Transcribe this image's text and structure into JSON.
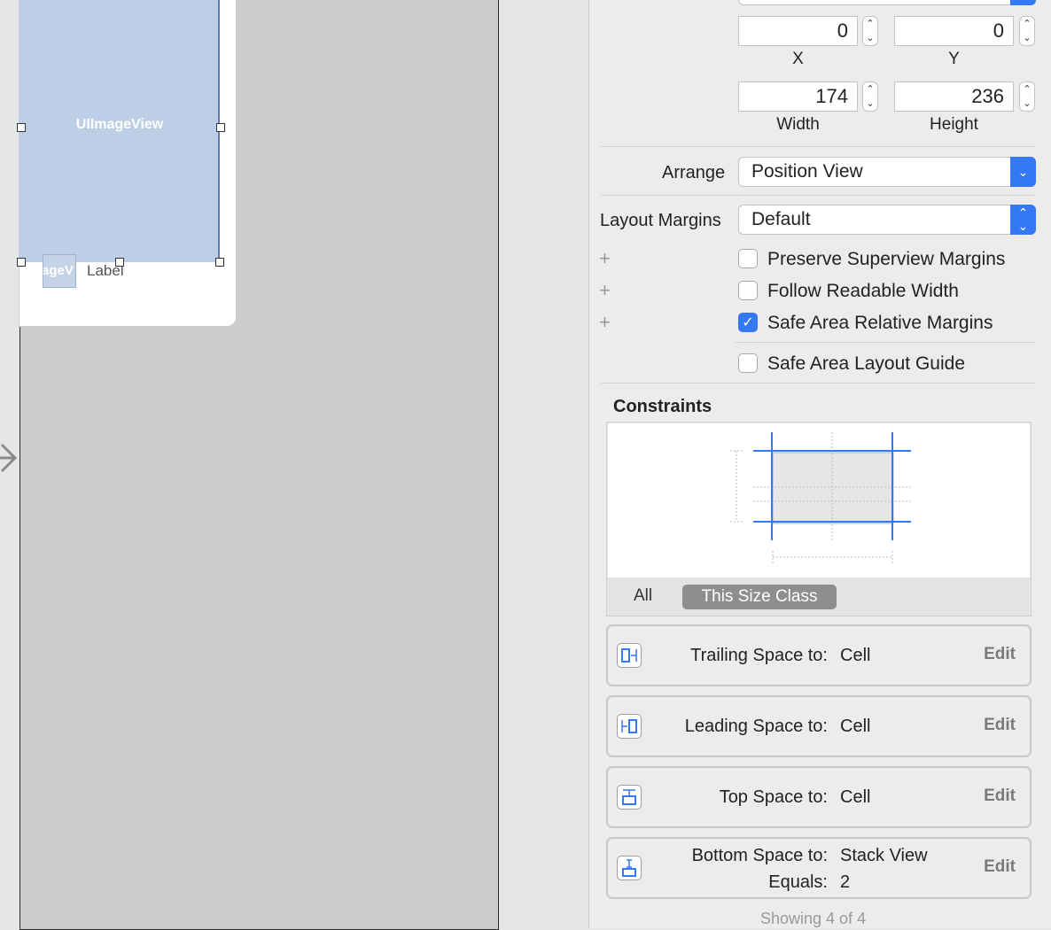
{
  "canvas": {
    "imageview_label": "UIImageView",
    "row_thumb_text": "ageV",
    "row_label": "Label"
  },
  "inspector": {
    "x_value": "0",
    "y_value": "0",
    "x_caption": "X",
    "y_caption": "Y",
    "width_value": "174",
    "height_value": "236",
    "width_caption": "Width",
    "height_caption": "Height",
    "arrange_label": "Arrange",
    "arrange_value": "Position View",
    "layout_margins_label": "Layout Margins",
    "layout_margins_value": "Default",
    "checkboxes": [
      {
        "label": "Preserve Superview Margins",
        "checked": false
      },
      {
        "label": "Follow Readable Width",
        "checked": false
      },
      {
        "label": "Safe Area Relative Margins",
        "checked": true
      },
      {
        "label": "Safe Area Layout Guide",
        "checked": false
      }
    ],
    "constraints_title": "Constraints",
    "segment_all": "All",
    "segment_size_class": "This Size Class",
    "constraint_rows": [
      {
        "label": "Trailing Space to:",
        "value": "Cell",
        "edit": "Edit",
        "icon": "trailing-space-icon"
      },
      {
        "label": "Leading Space to:",
        "value": "Cell",
        "edit": "Edit",
        "icon": "leading-space-icon"
      },
      {
        "label": "Top Space to:",
        "value": "Cell",
        "edit": "Edit",
        "icon": "top-space-icon"
      },
      {
        "label": "Bottom Space to:",
        "value": "Stack View",
        "label2": "Equals:",
        "value2": "2",
        "edit": "Edit",
        "icon": "bottom-space-icon"
      }
    ],
    "showing": "Showing 4 of 4",
    "accent_color": "#3478f6"
  }
}
